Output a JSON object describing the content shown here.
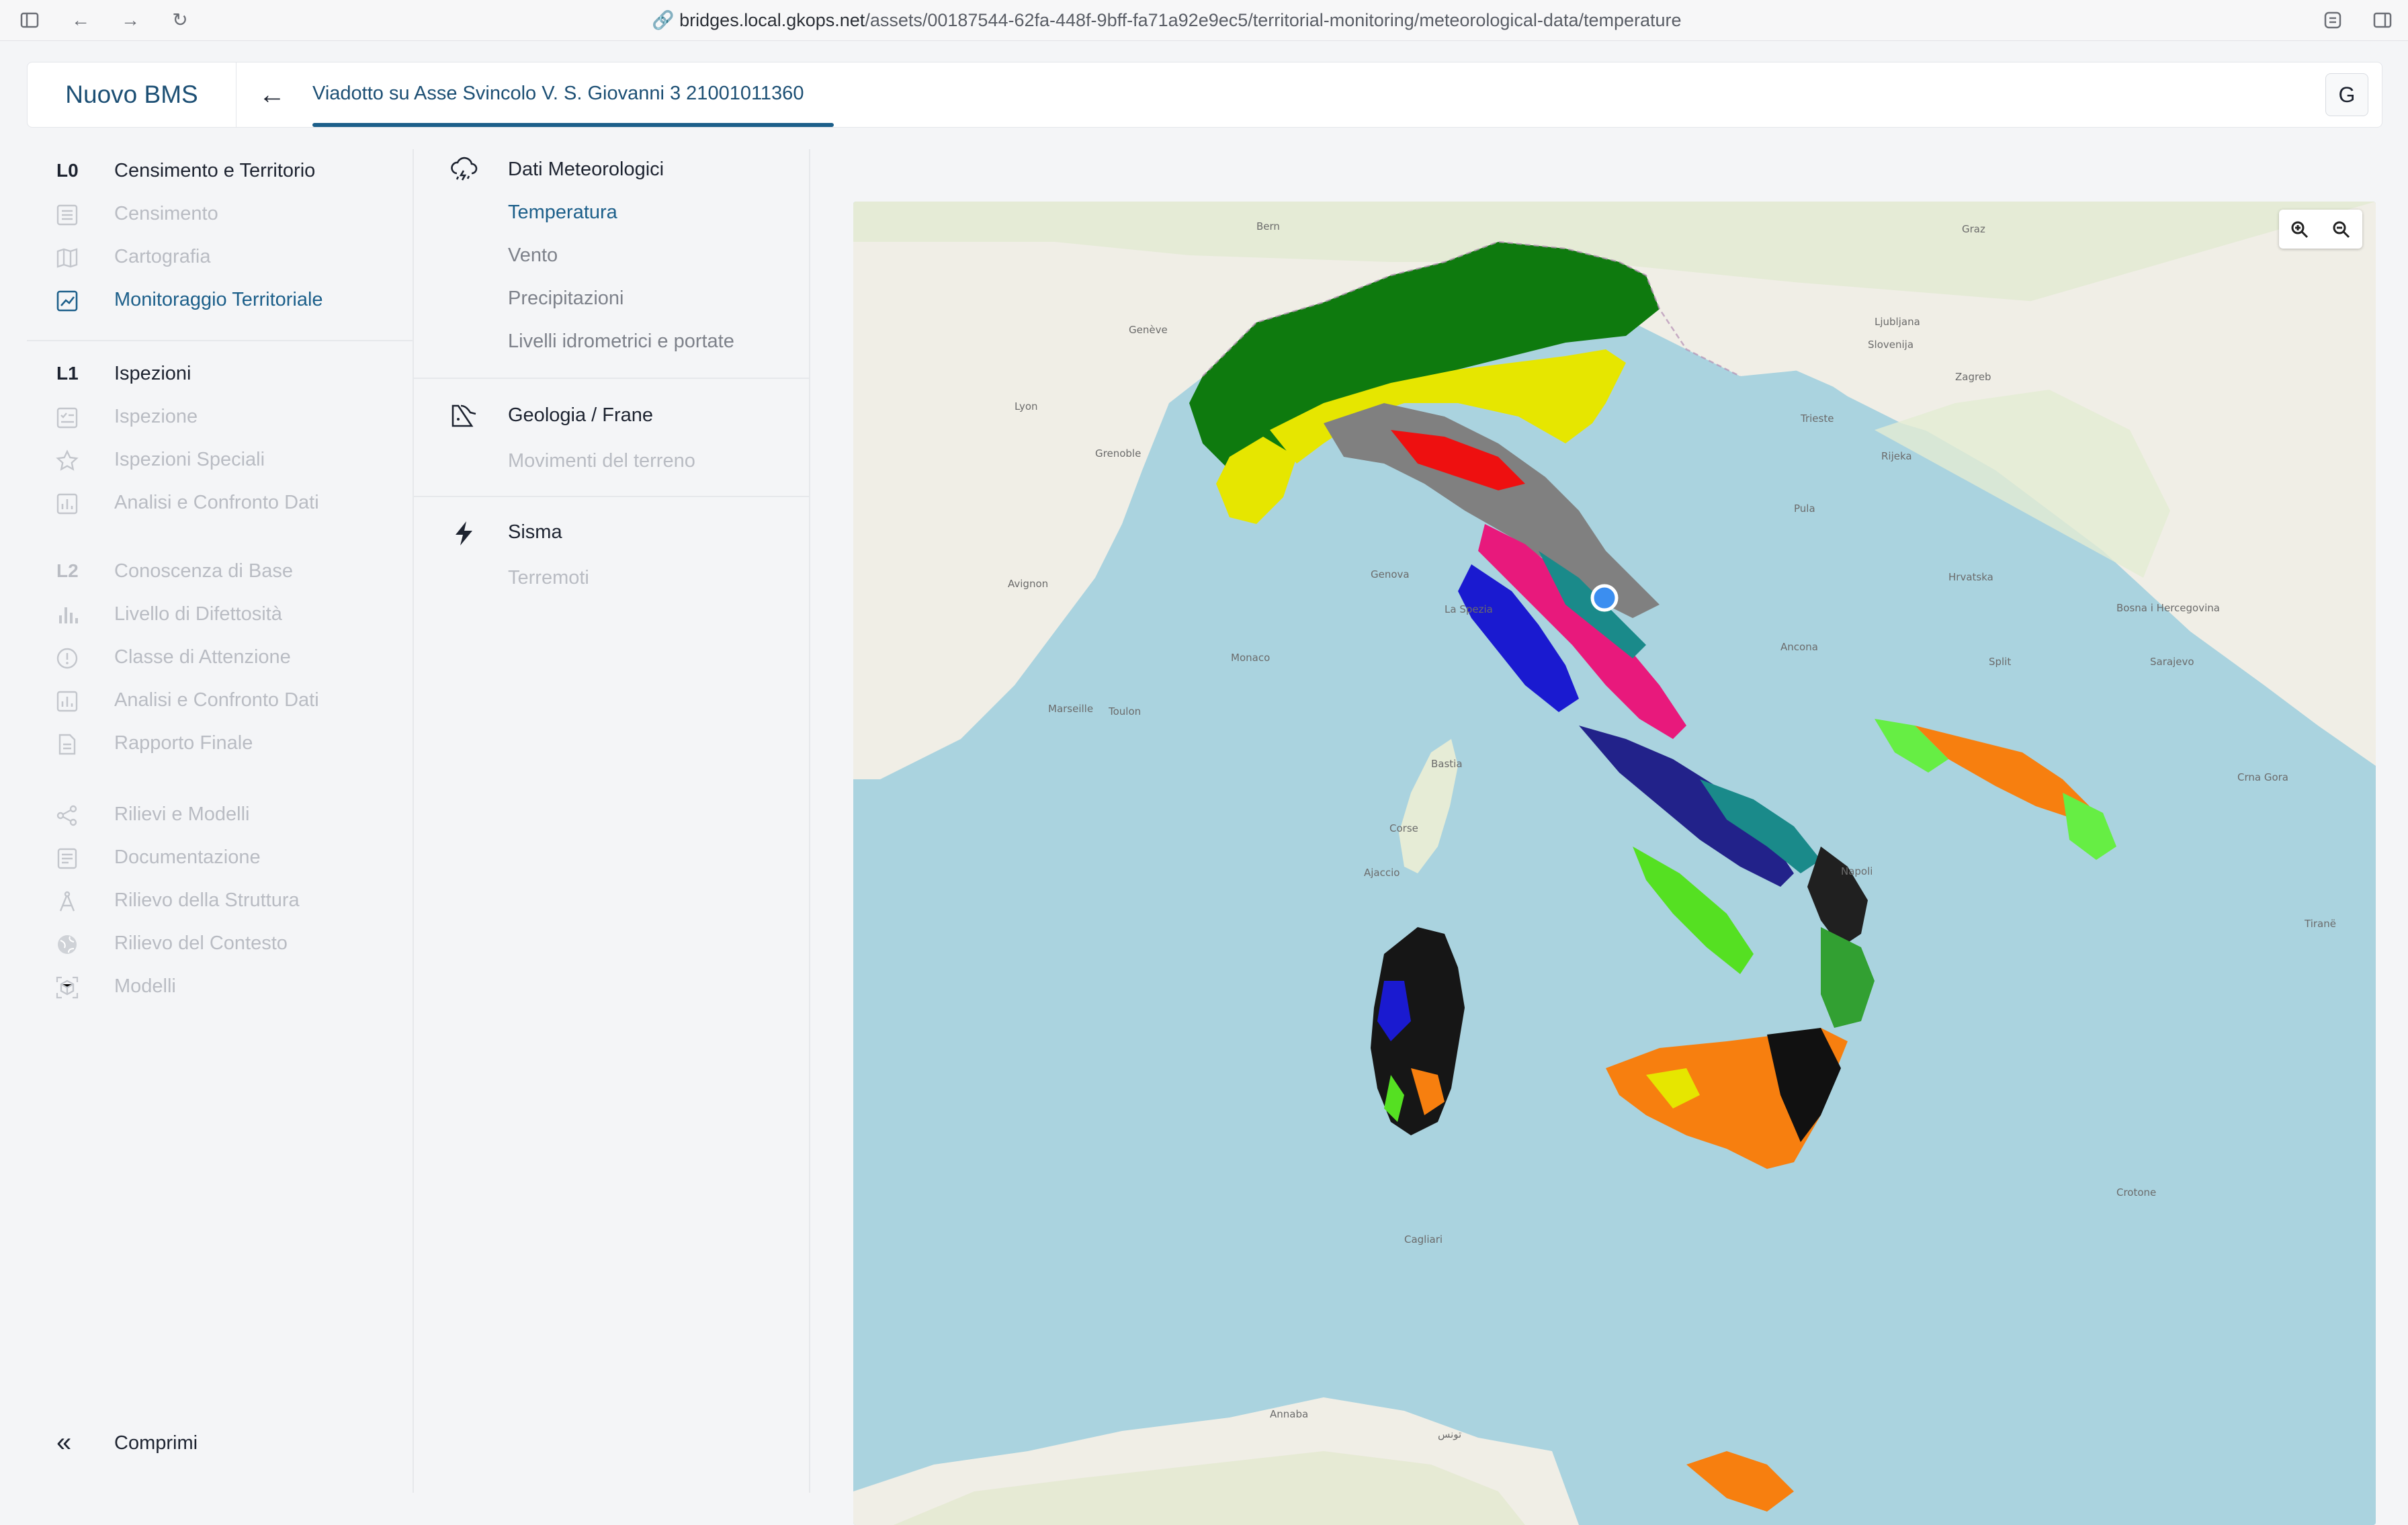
{
  "browser": {
    "url_host": "bridges.local.gkops.net",
    "url_path": "/assets/00187544-62fa-448f-9bff-fa71a92e9ec5/territorial-monitoring/meteorological-data/temperature"
  },
  "app": {
    "brand": "Nuovo BMS",
    "breadcrumb": "Viadotto su Asse Svincolo V. S. Giovanni 3 21001011360",
    "avatar_initial": "G",
    "accent_color": "#1c5f8a"
  },
  "sidebar": {
    "l0": {
      "level": "L0",
      "title": "Censimento e Territorio",
      "items": [
        "Censimento",
        "Cartografia",
        "Monitoraggio Territoriale"
      ]
    },
    "l1": {
      "level": "L1",
      "title": "Ispezioni",
      "items": [
        "Ispezione",
        "Ispezioni Speciali",
        "Analisi e Confronto Dati"
      ]
    },
    "l2": {
      "level": "L2",
      "title": "Conoscenza di Base",
      "items": [
        "Livello di Difettosità",
        "Classe di Attenzione",
        "Analisi e Confronto Dati",
        "Rapporto Finale"
      ]
    },
    "extra": [
      "Rilievi e Modelli",
      "Documentazione",
      "Rilievo della Struttura",
      "Rilievo del Contesto",
      "Modelli"
    ],
    "collapse_label": "Comprimi"
  },
  "middle": {
    "meteo": {
      "title": "Dati Meteorologici",
      "items": [
        "Temperatura",
        "Vento",
        "Precipitazioni",
        "Livelli idrometrici e portate"
      ]
    },
    "geo": {
      "title": "Geologia / Frane",
      "items": [
        "Movimenti del terreno"
      ]
    },
    "sisma": {
      "title": "Sisma",
      "items": [
        "Terremoti"
      ]
    }
  },
  "map": {
    "zoom_in": "+",
    "zoom_out": "−",
    "places": {
      "bern": "Bern",
      "geneve": "Genève",
      "lyon": "Lyon",
      "grenoble": "Grenoble",
      "marseille": "Marseille",
      "monaco": "Monaco",
      "genova": "Genova",
      "laspezia": "La Spezia",
      "trieste": "Trieste",
      "zagreb": "Zagreb",
      "ljubljana": "Ljubljana",
      "slovenija": "Slovenija",
      "hrvatska": "Hrvatska",
      "bastia": "Bastia",
      "ajaccio": "Ajaccio",
      "corse": "Corse",
      "ancona": "Ancona",
      "napoli": "Napoli",
      "crotone": "Crotone",
      "cagliari": "Cagliari",
      "tirane": "Tiranë",
      "sarajevo": "Sarajevo",
      "bosna": "Bosna i Hercegovina",
      "crnagora": "Crna Gora",
      "annaba": "Annaba",
      "tunis": "تونس",
      "split": "Split",
      "pula": "Pula",
      "rijeka": "Rijeka",
      "graz": "Graz",
      "avignon": "Avignon",
      "toulon": "Toulon"
    }
  }
}
